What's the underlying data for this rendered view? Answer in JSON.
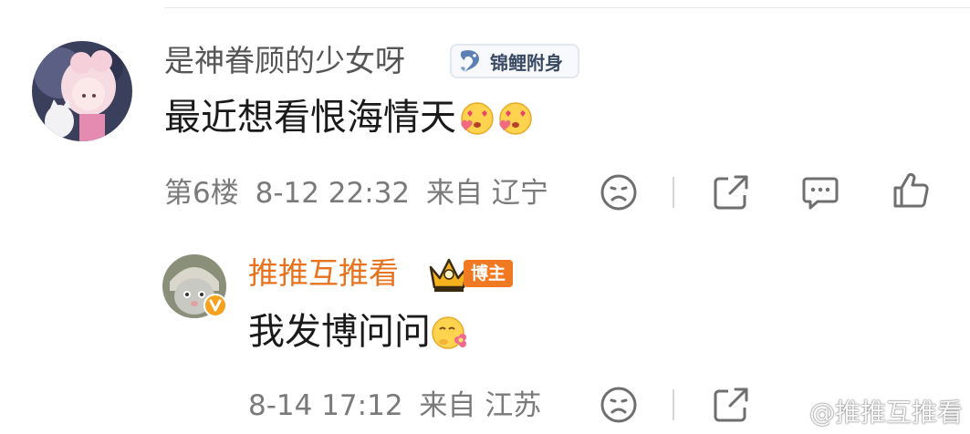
{
  "comment": {
    "username": "是神眷顾的少女呀",
    "badge_label": "锦鲤附身",
    "text": "最近想看恨海情天",
    "emojis": [
      "heart-eyes-emoji",
      "heart-eyes-emoji"
    ],
    "floor": "第6楼",
    "datetime": "8-12 22:32",
    "location": "来自 辽宁"
  },
  "reply": {
    "username": "推推互推看",
    "badge_label": "博主",
    "text": "我发博问问",
    "emoji": "flower-hug-emoji",
    "datetime": "8-14 17:12",
    "location": "来自 江苏"
  },
  "watermark": {
    "text": "@推推互推看",
    "icon": "weibo-logo-icon"
  },
  "colors": {
    "username": "#565656",
    "blogger_name": "#e8731e",
    "meta": "#7a7a7a",
    "blogger_badge": "#f07a22",
    "vip_badge": "#f6b21c"
  },
  "icons": [
    "sad-face-icon",
    "share-icon",
    "comment-icon",
    "like-icon"
  ]
}
